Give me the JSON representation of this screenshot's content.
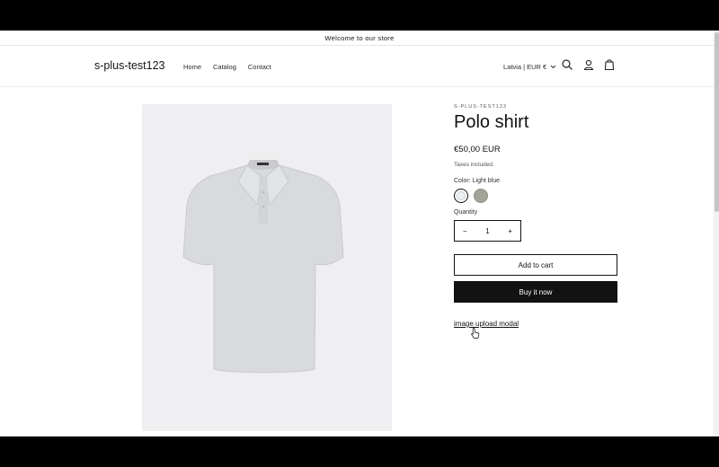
{
  "announcement": {
    "text": "Welcome to our store"
  },
  "header": {
    "logo": "s-plus-test123",
    "nav": [
      "Home",
      "Catalog",
      "Contact"
    ],
    "locale": "Latvia | EUR €",
    "icons": [
      "search-icon",
      "account-icon",
      "cart-icon"
    ]
  },
  "product": {
    "vendor": "S-PLUS-TEST123",
    "title": "Polo shirt",
    "price": "€50,00 EUR",
    "taxes": "Taxes included.",
    "color_label": "Color: Light blue",
    "swatches": [
      {
        "name": "Light blue",
        "color": "#eceff3",
        "selected": true
      },
      {
        "name": "Olive",
        "color": "#a3a398",
        "selected": false
      }
    ],
    "quantity_label": "Quantity",
    "quantity": "1",
    "minus": "−",
    "plus": "+",
    "add_to_cart": "Add to cart",
    "buy_now": "Buy it now",
    "modal_link": "image upload modal"
  }
}
